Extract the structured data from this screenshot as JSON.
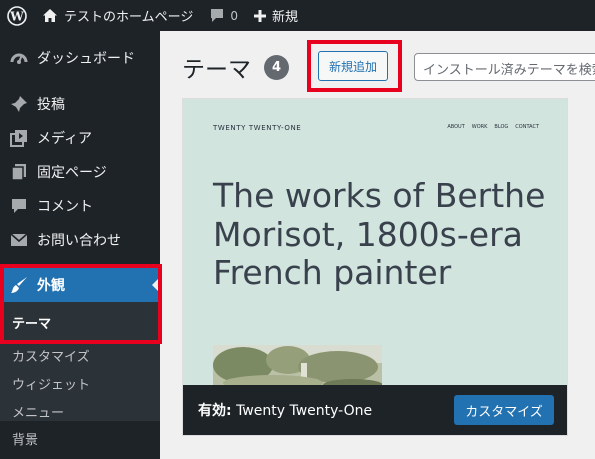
{
  "adminbar": {
    "site_name": "テストのホームページ",
    "comments_count": "0",
    "new_label": "新規"
  },
  "sidebar": {
    "items": [
      {
        "label": "ダッシュボード",
        "icon": "dashboard-icon"
      },
      {
        "label": "投稿",
        "icon": "pin-icon"
      },
      {
        "label": "メディア",
        "icon": "media-icon"
      },
      {
        "label": "固定ページ",
        "icon": "page-icon"
      },
      {
        "label": "コメント",
        "icon": "comment-icon"
      },
      {
        "label": "お問い合わせ",
        "icon": "mail-icon"
      },
      {
        "label": "外観",
        "icon": "paintbrush-icon",
        "active": true
      }
    ],
    "submenu": [
      "テーマ",
      "カスタマイズ",
      "ウィジェット",
      "メニュー",
      "背景"
    ]
  },
  "main": {
    "title": "テーマ",
    "count": "4",
    "add_new": "新規追加",
    "search_placeholder": "インストール済みテーマを検索..."
  },
  "theme": {
    "site_title": "TWENTY TWENTY-ONE",
    "nav": [
      "ABOUT",
      "WORK",
      "BLOG",
      "CONTACT"
    ],
    "headline": "The works of Berthe Morisot, 1800s-era French painter",
    "active_prefix": "有効:",
    "name": "Twenty Twenty-One",
    "customize": "カスタマイズ"
  },
  "colors": {
    "adminbar_bg": "#1d2327",
    "accent": "#2271b1",
    "highlight": "#e8001f",
    "theme_bg": "#d1e4dd"
  }
}
